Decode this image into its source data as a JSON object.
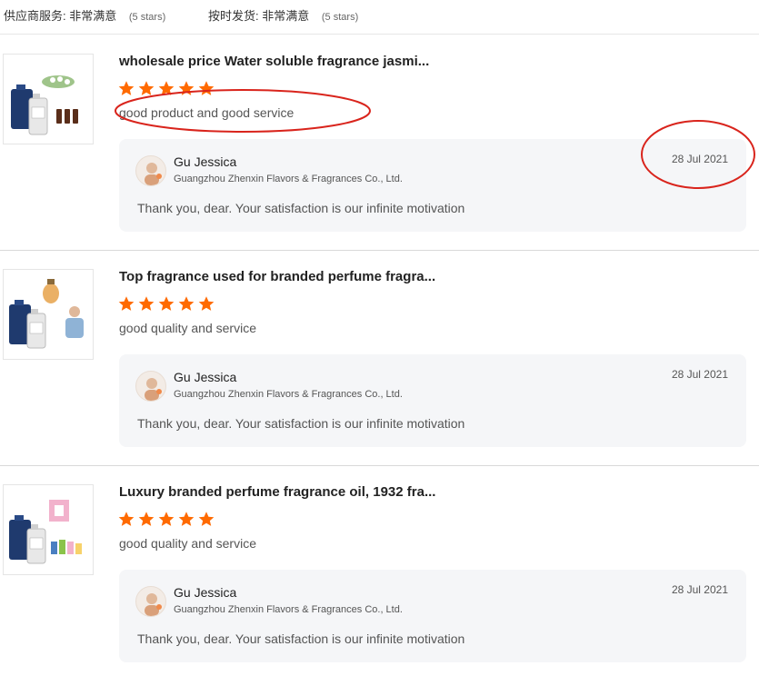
{
  "summary": {
    "supplier_service_label": "供应商服务:",
    "supplier_service_value": "非常满意",
    "supplier_service_stars": "(5 stars)",
    "on_time_label": "按时发货:",
    "on_time_value": "非常满意",
    "on_time_stars": "(5 stars)"
  },
  "colors": {
    "star": "#ff6a00",
    "annotation": "#d9241c",
    "reply_bg": "#f5f6f8"
  },
  "reviews": [
    {
      "title": "wholesale price Water soluble fragrance jasmi...",
      "rating": 5,
      "comment": "good product and good service",
      "reply": {
        "name": "Gu Jessica",
        "company": "Guangzhou Zhenxin Flavors & Fragrances Co., Ltd.",
        "date": "28 Jul 2021",
        "text": "Thank you, dear. Your satisfaction is our infinite motivation"
      }
    },
    {
      "title": "Top fragrance used for branded perfume fragra...",
      "rating": 5,
      "comment": "good quality and service",
      "reply": {
        "name": "Gu Jessica",
        "company": "Guangzhou Zhenxin Flavors & Fragrances Co., Ltd.",
        "date": "28 Jul 2021",
        "text": "Thank you, dear. Your satisfaction is our infinite motivation"
      }
    },
    {
      "title": "Luxury branded perfume fragrance oil, 1932 fra...",
      "rating": 5,
      "comment": "good quality and service",
      "reply": {
        "name": "Gu Jessica",
        "company": "Guangzhou Zhenxin Flavors & Fragrances Co., Ltd.",
        "date": "28 Jul 2021",
        "text": "Thank you, dear. Your satisfaction is our infinite motivation"
      }
    }
  ]
}
